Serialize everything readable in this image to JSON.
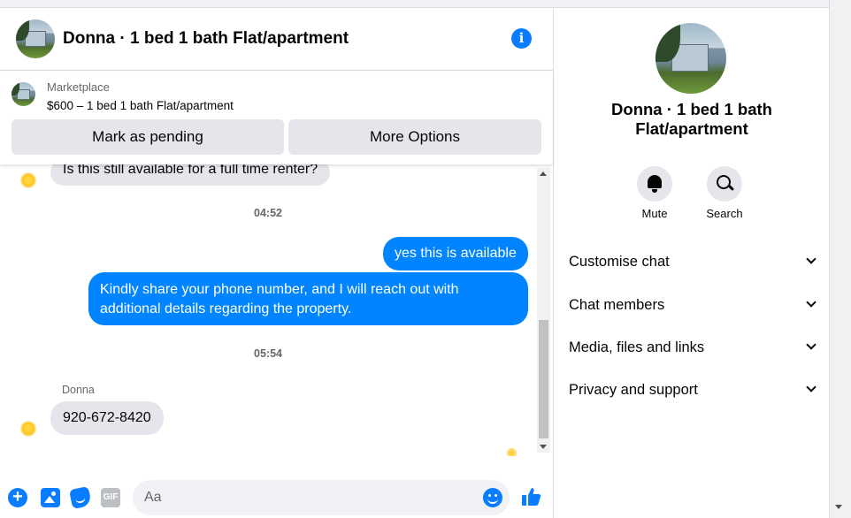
{
  "header": {
    "title": "Donna · 1 bed 1 bath Flat/apartment"
  },
  "marketplace": {
    "label": "Marketplace",
    "listing": "$600 – 1 bed 1 bath Flat/apartment",
    "buttons": {
      "pending": "Mark as pending",
      "more": "More Options"
    }
  },
  "messages": {
    "items": [
      {
        "from": "Donna",
        "text": "Is this still available for a full time renter?"
      },
      {
        "timestamp": "04:52"
      },
      {
        "from": "me",
        "text": "yes this is available"
      },
      {
        "from": "me",
        "text": "Kindly share your phone number, and I will reach out with additional details regarding the property."
      },
      {
        "timestamp": "05:54"
      },
      {
        "from": "Donna",
        "sender_label": "Donna",
        "text": "920-672-8420"
      }
    ]
  },
  "composer": {
    "placeholder": "Aa",
    "gif_label": "GIF",
    "icons": [
      "plus-icon",
      "photo-icon",
      "sticker-icon",
      "gif-icon",
      "emoji-icon",
      "thumbs-up-icon"
    ]
  },
  "info_panel": {
    "name_line1": "Donna · 1 bed 1 bath",
    "name_line2": "Flat/apartment",
    "actions": {
      "mute": "Mute",
      "search": "Search"
    },
    "sections": [
      "Customise chat",
      "Chat members",
      "Media, files and links",
      "Privacy and support"
    ]
  },
  "colors": {
    "accent": "#0084ff",
    "incoming_bubble": "#e4e6eb",
    "button_bg": "#e4e6eb"
  }
}
